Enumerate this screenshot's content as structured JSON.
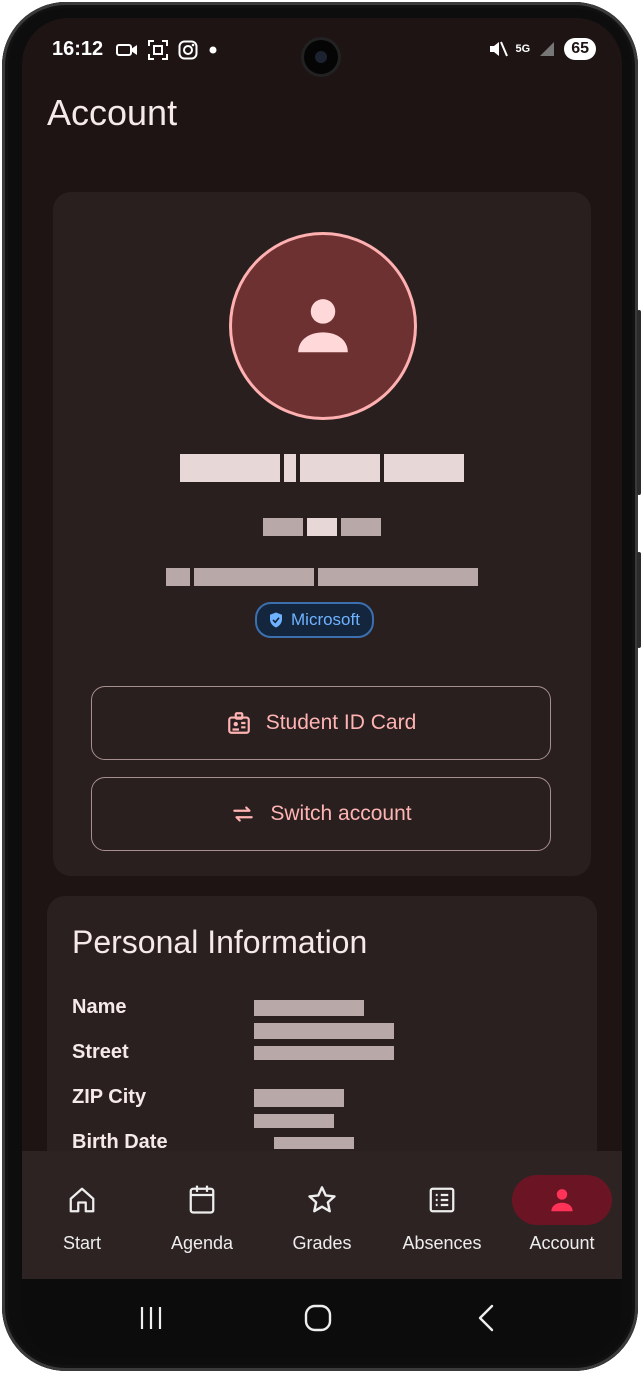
{
  "status": {
    "time": "16:12",
    "network": "5G",
    "battery": "65"
  },
  "header": {
    "title": "Account"
  },
  "profile": {
    "badge_label": "Microsoft",
    "student_id_label": "Student ID Card",
    "switch_account_label": "Switch account"
  },
  "personal_info": {
    "title": "Personal Information",
    "rows": [
      {
        "label": "Name"
      },
      {
        "label": "Street"
      },
      {
        "label": "ZIP City"
      },
      {
        "label": "Birth Date"
      }
    ]
  },
  "nav": {
    "items": [
      {
        "label": "Start",
        "icon": "home-icon"
      },
      {
        "label": "Agenda",
        "icon": "calendar-icon"
      },
      {
        "label": "Grades",
        "icon": "star-icon"
      },
      {
        "label": "Absences",
        "icon": "list-icon"
      },
      {
        "label": "Account",
        "icon": "person-icon",
        "active": true
      }
    ]
  },
  "colors": {
    "accent": "#ffb3b3",
    "active_nav_icon": "#ff3358",
    "badge": "#6fb2ff"
  }
}
